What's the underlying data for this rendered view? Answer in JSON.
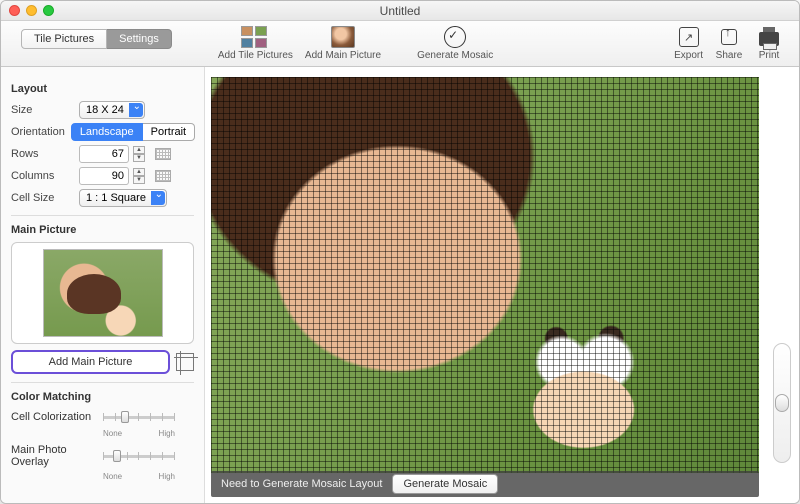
{
  "window": {
    "title": "Untitled"
  },
  "tabs": {
    "tile": "Tile Pictures",
    "settings": "Settings"
  },
  "toolbar": {
    "add_tile": "Add Tile Pictures",
    "add_main": "Add Main Picture",
    "generate": "Generate Mosaic",
    "export": "Export",
    "share": "Share",
    "print": "Print"
  },
  "layout": {
    "heading": "Layout",
    "size_label": "Size",
    "size_value": "18 X 24",
    "orientation_label": "Orientation",
    "orientation_landscape": "Landscape",
    "orientation_portrait": "Portrait",
    "rows_label": "Rows",
    "rows_value": "67",
    "columns_label": "Columns",
    "columns_value": "90",
    "cellsize_label": "Cell Size",
    "cellsize_value": "1 : 1 Square"
  },
  "main_picture": {
    "heading": "Main Picture",
    "add_button": "Add Main Picture"
  },
  "color_matching": {
    "heading": "Color Matching",
    "cell_colorization": "Cell Colorization",
    "main_overlay": "Main Photo Overlay",
    "none": "None",
    "high": "High"
  },
  "status": {
    "message": "Need to Generate Mosaic Layout",
    "button": "Generate Mosaic"
  }
}
